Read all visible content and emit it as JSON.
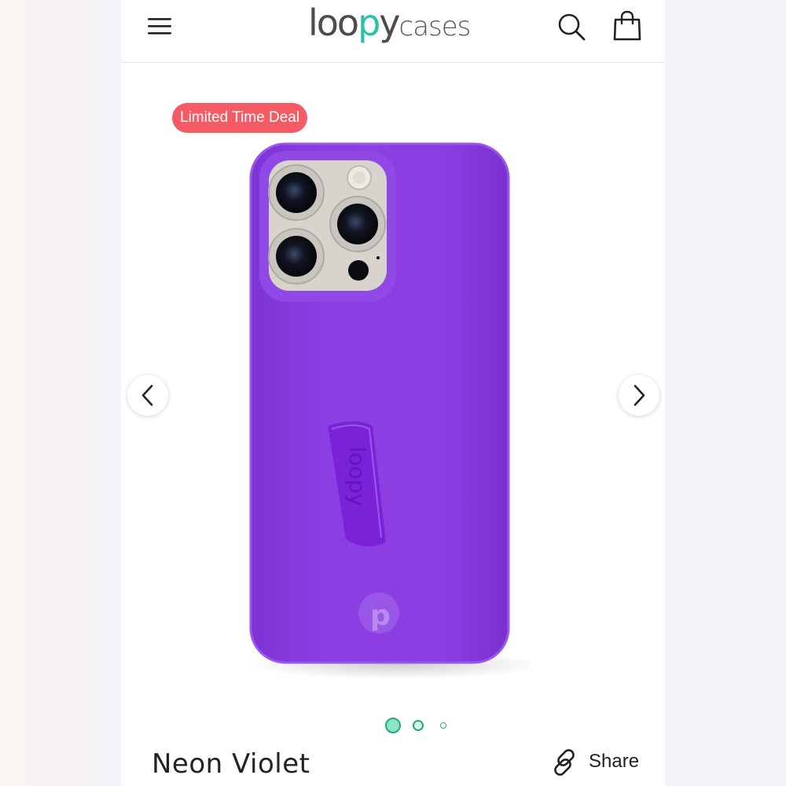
{
  "header": {
    "logo_part_1": "loo",
    "logo_part_2": "p",
    "logo_part_3": "y",
    "logo_part_4": "cases",
    "menu_icon": "hamburger-menu-icon",
    "search_icon": "search-icon",
    "cart_icon": "shopping-bag-icon"
  },
  "gallery": {
    "badge": "Limited Time Deal",
    "image_alt_text": "loopy",
    "prev_icon": "chevron-left-icon",
    "next_icon": "chevron-right-icon",
    "active_dot": 1,
    "dot_count": 3
  },
  "product": {
    "title": "Neon Violet",
    "share_label": "Share",
    "share_icon": "link-icon"
  },
  "colors": {
    "brand_green": "#27c3a6",
    "badge_red": "#f45b64",
    "case_purple": "#8a3ee0"
  }
}
